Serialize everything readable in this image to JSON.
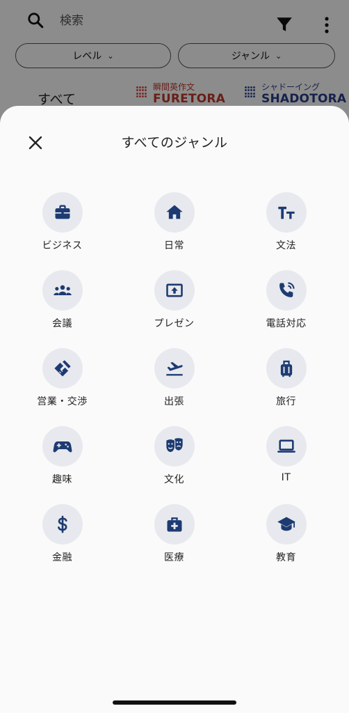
{
  "search": {
    "placeholder": "検索"
  },
  "filters": {
    "level": "レベル",
    "genre": "ジャンル",
    "chevron": "⌄"
  },
  "tabs": {
    "all": "すべて",
    "furetora": {
      "sub": "瞬間英作文",
      "main": "FURETORA"
    },
    "shadotora": {
      "sub": "シャドーイング",
      "main": "SHADOTORA"
    }
  },
  "sheet": {
    "title": "すべてのジャンル",
    "genres": [
      {
        "label": "ビジネス",
        "icon": "briefcase-icon"
      },
      {
        "label": "日常",
        "icon": "home-icon"
      },
      {
        "label": "文法",
        "icon": "text-size-icon"
      },
      {
        "label": "会議",
        "icon": "group-icon"
      },
      {
        "label": "プレゼン",
        "icon": "presentation-icon"
      },
      {
        "label": "電話対応",
        "icon": "phone-icon"
      },
      {
        "label": "営業・交渉",
        "icon": "handshake-icon"
      },
      {
        "label": "出張",
        "icon": "airplane-icon"
      },
      {
        "label": "旅行",
        "icon": "luggage-icon"
      },
      {
        "label": "趣味",
        "icon": "gamepad-icon"
      },
      {
        "label": "文化",
        "icon": "theater-masks-icon"
      },
      {
        "label": "IT",
        "icon": "laptop-icon"
      },
      {
        "label": "金融",
        "icon": "dollar-icon"
      },
      {
        "label": "医療",
        "icon": "medical-kit-icon"
      },
      {
        "label": "教育",
        "icon": "graduation-cap-icon"
      }
    ]
  },
  "colors": {
    "accent": "#1d3b72",
    "icon_bg": "#e8e9ee",
    "overlay": "rgba(0,0,0,0.45)"
  }
}
